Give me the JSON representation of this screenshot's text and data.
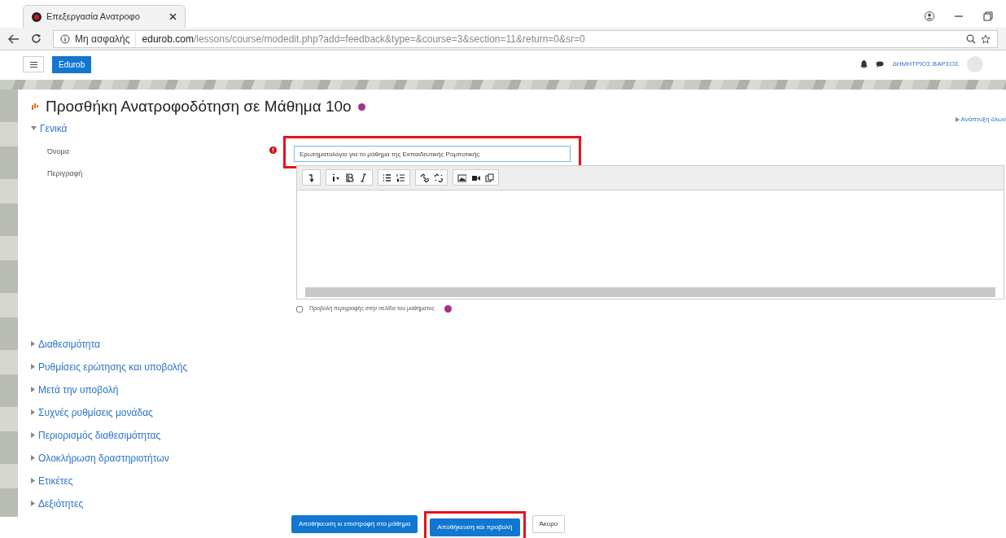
{
  "browser": {
    "tab_title": "Επεξεργασία Ανατροφο",
    "security": "Μη ασφαλής",
    "url_host": "edurob.com",
    "url_path": "/lessons/course/modedit.php?add=feedback&type=&course=3&section=11&return=0&sr=0"
  },
  "navbar": {
    "brand": "Edurob",
    "user": "ΔΗΜΗΤΡΙΟΣ ΒΑΡΣΟΣ"
  },
  "page": {
    "title": "Προσθήκη Ανατροφοδότηση σε Μάθημα 10ο",
    "expand_all": "Ανάπτυξη όλων"
  },
  "general": {
    "label": "Γενικά",
    "expanded": true,
    "name_field": {
      "label": "Όνομα",
      "value": "Ερωτηματολόγιο για το μάθημα της Εκπαιδευτικής Ρομποτικής",
      "required": true,
      "highlighted": true
    },
    "description": {
      "label": "Περιγραφή"
    },
    "show_description": {
      "label": "Προβολή περιγραφής στην σελίδα του μαθήματος",
      "checked": false
    }
  },
  "sections": [
    {
      "label": "Διαθεσιμότητα",
      "expanded": false
    },
    {
      "label": "Ρυθμίσεις ερώτησης και υποβολής",
      "expanded": false
    },
    {
      "label": "Μετά την υποβολή",
      "expanded": false
    },
    {
      "label": "Συχνές ρυθμίσεις μονάδας",
      "expanded": false
    },
    {
      "label": "Περιορισμός διαθεσιμότητας",
      "expanded": false
    },
    {
      "label": "Ολοκλήρωση δραστηριοτήτων",
      "expanded": false
    },
    {
      "label": "Ετικέτες",
      "expanded": false
    },
    {
      "label": "Δεξιότητες",
      "expanded": false
    }
  ],
  "buttons": [
    {
      "label": "Αποθήκευση κι επιστροφή στο μάθημα",
      "kind": "primary",
      "highlighted": false
    },
    {
      "label": "Αποθήκευση και προβολή",
      "kind": "primary",
      "highlighted": true
    },
    {
      "label": "Άκυρο",
      "kind": "secondary",
      "highlighted": false
    }
  ]
}
